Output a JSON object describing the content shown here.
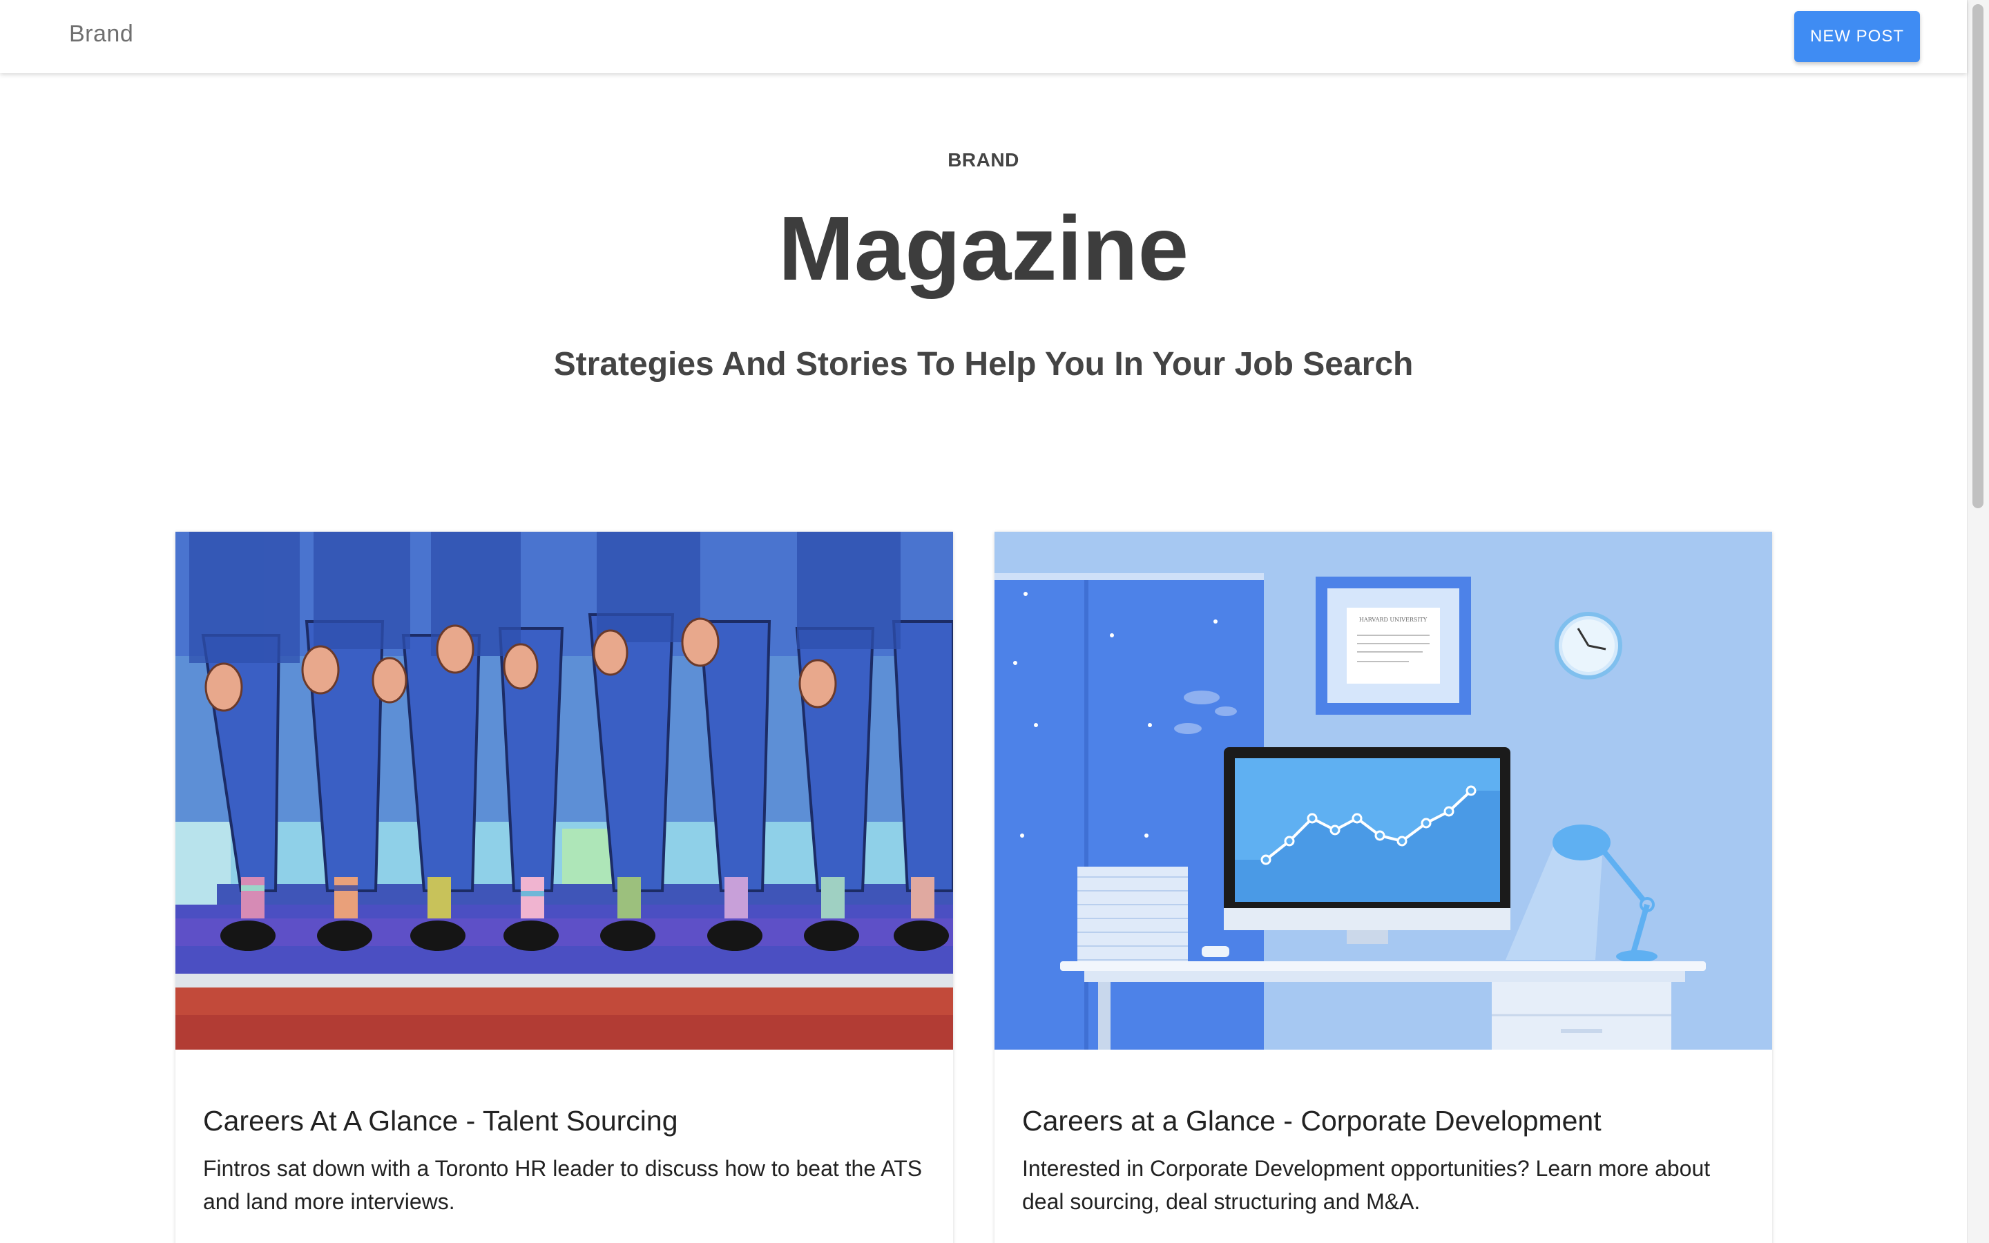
{
  "navbar": {
    "brand": "Brand",
    "new_post_label": "NEW POST"
  },
  "header": {
    "kicker": "BRAND",
    "title": "Magazine",
    "subtitle": "Strategies And Stories To Help You In Your Job Search"
  },
  "cards": [
    {
      "title": "Careers At A Glance - Talent Sourcing",
      "description": "Fintros sat down with a Toronto HR leader to discuss how to beat the ATS and land more interviews.",
      "image": "suits-and-socks-illustration"
    },
    {
      "title": "Careers at a Glance - Corporate Development",
      "description": "Interested in Corporate Development opportunities? Learn more about deal sourcing, deal structuring and M&A.",
      "image": "office-desk-illustration",
      "diploma_text": "HARVARD UNIVERSITY"
    }
  ],
  "colors": {
    "accent": "#3f8cf3",
    "text_dark": "#3d3d3d",
    "brand_gray": "#6f6f6f"
  }
}
